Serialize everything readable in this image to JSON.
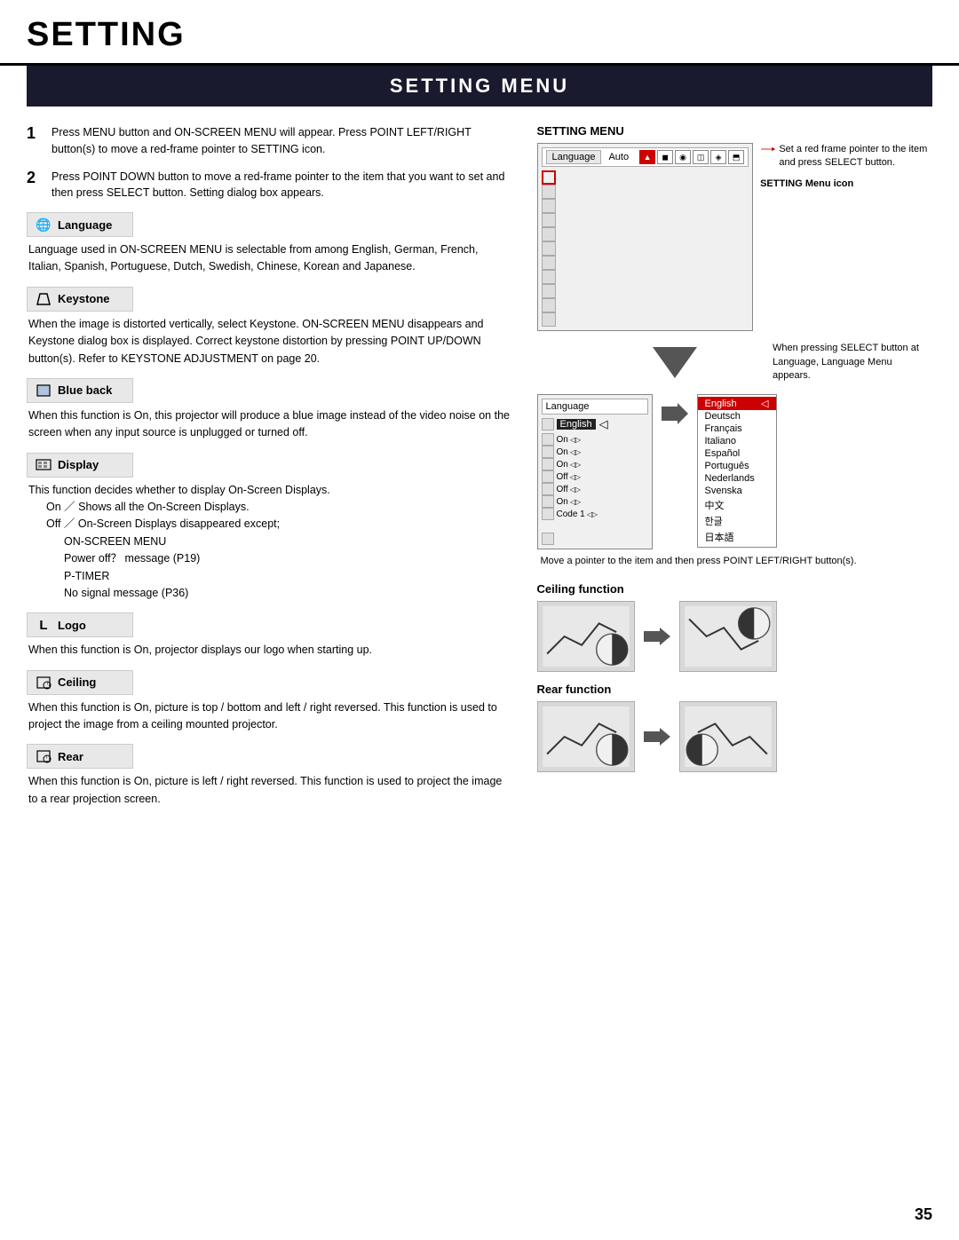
{
  "page": {
    "title": "SETTING",
    "section_title": "SETTING MENU",
    "page_number": "35"
  },
  "steps": [
    {
      "num": "1",
      "text": "Press MENU button and ON-SCREEN MENU will appear.  Press POINT LEFT/RIGHT button(s) to move a red-frame pointer to SETTING icon."
    },
    {
      "num": "2",
      "text": "Press POINT DOWN button to move a red-frame pointer to the item that you want to set and then press SELECT button. Setting dialog box appears."
    }
  ],
  "features": [
    {
      "id": "language",
      "icon": "🌐",
      "label": "Language",
      "body": "Language used in ON-SCREEN MENU is selectable from among English, German, French, Italian, Spanish, Portuguese, Dutch, Swedish, Chinese, Korean and Japanese."
    },
    {
      "id": "keystone",
      "icon": "⬜",
      "label": "Keystone",
      "body": "When the image is distorted vertically, select Keystone.  ON-SCREEN MENU disappears and Keystone dialog box is displayed. Correct keystone distortion by pressing POINT UP/DOWN button(s). Refer to KEYSTONE ADJUSTMENT on page 20."
    },
    {
      "id": "blueback",
      "icon": "◻",
      "label": "Blue back",
      "body": "When this function is  On,  this projector will produce a blue image instead of the video noise on the screen when any input source is unplugged or turned off."
    },
    {
      "id": "display",
      "icon": "⬛",
      "label": "Display",
      "body_lines": [
        "This function decides whether to display On-Screen Displays.",
        "On  ／  Shows all the On-Screen Displays.",
        "Off  ／  On-Screen Displays disappeared except;",
        "ON-SCREEN MENU",
        "Power off？  message (P19)",
        "P-TIMER",
        "No signal  message (P36)"
      ]
    },
    {
      "id": "logo",
      "icon": "L",
      "label": "Logo",
      "body": "When this function is  On,  projector displays our logo when starting up."
    },
    {
      "id": "ceiling",
      "icon": "⬜",
      "label": "Ceiling",
      "body": "When this function is  On,  picture is top / bottom and left / right reversed.  This function is used to project the image from a ceiling mounted projector."
    },
    {
      "id": "rear",
      "icon": "⬜",
      "label": "Rear",
      "body": "When this function is  On,  picture is left / right reversed.  This function is used to project the image to a rear projection screen."
    }
  ],
  "right_panel": {
    "setting_menu_title": "SETTING MENU",
    "menu_bar": {
      "label": "Language",
      "value": "Auto"
    },
    "annotation1": "Set a red frame pointer to the item and press SELECT button.",
    "annotation2": "SETTING Menu icon",
    "arrow_label": "",
    "annotation3": "When pressing SELECT button at Language, Language Menu appears.",
    "language_menu_label": "Language",
    "language_current": "English",
    "language_list": [
      {
        "name": "English",
        "selected": true
      },
      {
        "name": "Deutsch"
      },
      {
        "name": "Français"
      },
      {
        "name": "Italiano"
      },
      {
        "name": "Español"
      },
      {
        "name": "Português"
      },
      {
        "name": "Nederlands"
      },
      {
        "name": "Svenska"
      },
      {
        "name": "中文"
      },
      {
        "name": "한글"
      },
      {
        "name": "日本語"
      }
    ],
    "annotation4": "Move a pointer to the item and then press POINT LEFT/RIGHT button(s).",
    "ceiling_function_title": "Ceiling function",
    "rear_function_title": "Rear function"
  }
}
